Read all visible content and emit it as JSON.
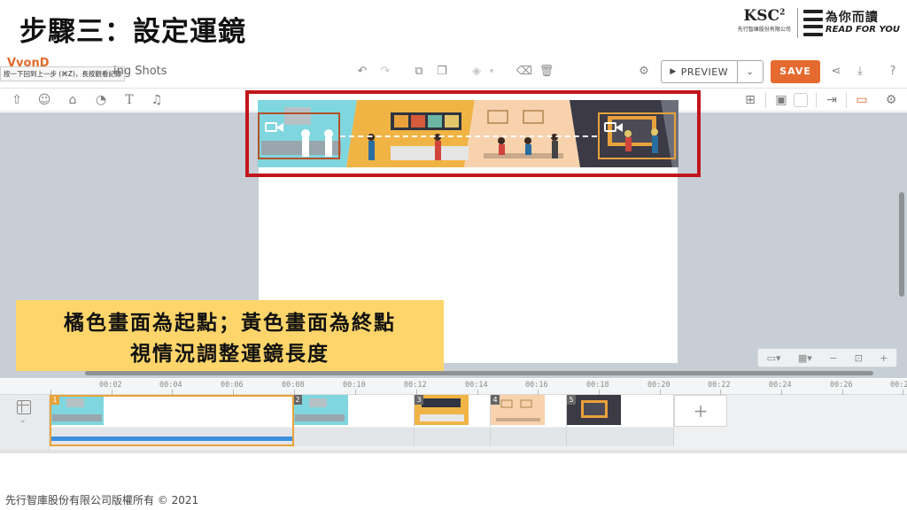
{
  "slide": {
    "title": "步驟三：設定運鏡",
    "copyright": "先行智庫股份有限公司版權所有 © 2021"
  },
  "logos": {
    "ksc_mark": "KSC",
    "ksc_sup": "2",
    "ksc_sub": "先行智庫股份有限公司",
    "rfy_cn": "為你而讀",
    "rfy_en": "READ FOR YOU"
  },
  "topbar": {
    "brand_partial": "VyonD",
    "tooltip": "按一下回到上一步 (⌘Z)，長按觀看記錄",
    "project_name": "ing Shots",
    "preview_label": "PREVIEW",
    "save_label": "SAVE"
  },
  "callout": {
    "line1": "橘色畫面為起點；黃色畫面為終點",
    "line2": "視情況調整運鏡長度"
  },
  "timeline": {
    "ruler": [
      "00:02",
      "00:04",
      "00:06",
      "00:08",
      "00:10",
      "00:12",
      "00:14",
      "00:16",
      "00:18",
      "00:20",
      "00:22",
      "00:24",
      "00:26",
      "00:2"
    ],
    "scenes": [
      {
        "num": "1"
      },
      {
        "num": "2"
      },
      {
        "num": "3"
      },
      {
        "num": "4"
      },
      {
        "num": "5"
      }
    ],
    "add_label": "+"
  },
  "colors": {
    "save": "#e56a2f",
    "start_frame": "#b5502a",
    "end_frame": "#e8a23a",
    "highlight_box": "#c0161c",
    "callout_bg": "#fdd56a",
    "workspace": "#c7ced6",
    "selection_bar": "#3d8fe0"
  },
  "icons": {
    "topbar": [
      "undo-icon",
      "redo-icon",
      "copy-icon",
      "paste-icon",
      "layers-icon",
      "paint-icon",
      "trash-icon",
      "settings-icon",
      "share-icon",
      "download-icon",
      "help-icon"
    ],
    "assetbar": [
      "upload-icon",
      "character-icon",
      "props-icon",
      "chart-icon",
      "text-icon",
      "music-icon",
      "swap-icon",
      "image-icon",
      "exit-icon",
      "camera-icon",
      "settings-icon"
    ]
  }
}
